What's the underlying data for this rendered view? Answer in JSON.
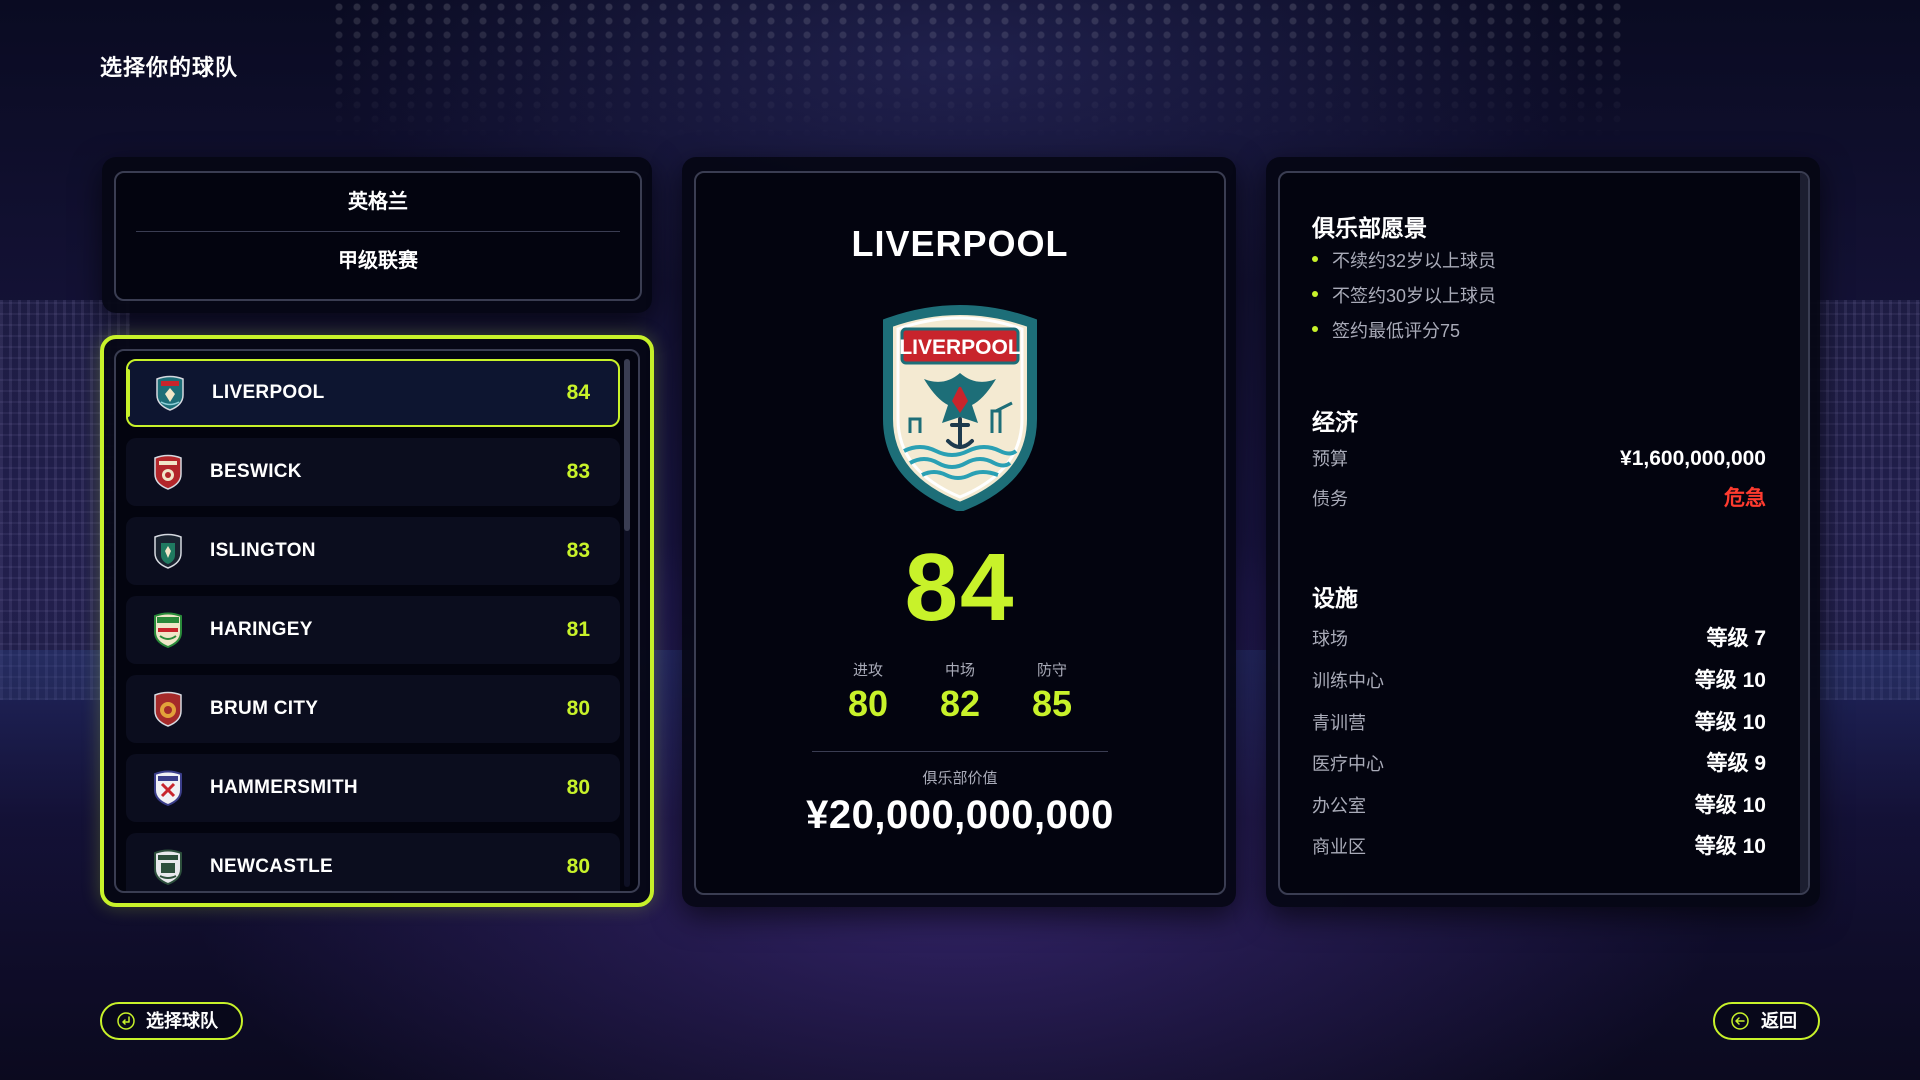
{
  "screen_title": "选择你的球队",
  "league_selector": {
    "country": "英格兰",
    "league": "甲级联赛"
  },
  "teams": [
    {
      "name": "LIVERPOOL",
      "rating": "84",
      "crest_color": "#1d6e78",
      "selected": true
    },
    {
      "name": "BESWICK",
      "rating": "83",
      "crest_color": "#b3262a",
      "selected": false
    },
    {
      "name": "ISLINGTON",
      "rating": "83",
      "crest_color": "#1f5f4e",
      "selected": false
    },
    {
      "name": "HARINGEY",
      "rating": "81",
      "crest_color": "#2a8a3a",
      "selected": false
    },
    {
      "name": "BRUM CITY",
      "rating": "80",
      "crest_color": "#a52a2a",
      "selected": false
    },
    {
      "name": "HAMMERSMITH",
      "rating": "80",
      "crest_color": "#3b3e8a",
      "selected": false
    },
    {
      "name": "NEWCASTLE",
      "rating": "80",
      "crest_color": "#2d4f3c",
      "selected": false
    }
  ],
  "detail": {
    "team_name": "LIVERPOOL",
    "crest_text": "LIVERPOOL",
    "overall": "84",
    "attack_label": "进攻",
    "attack": "80",
    "midfield_label": "中场",
    "midfield": "82",
    "defense_label": "防守",
    "defense": "85",
    "value_label": "俱乐部价值",
    "value": "¥20,000,000,000"
  },
  "info": {
    "vision_title": "俱乐部愿景",
    "vision_items": [
      "不续约32岁以上球员",
      "不签约30岁以上球员",
      "签约最低评分75"
    ],
    "economy_title": "经济",
    "budget_label": "预算",
    "budget_value": "¥1,600,000,000",
    "debt_label": "债务",
    "debt_value": "危急",
    "facilities_title": "设施",
    "facilities": [
      {
        "label": "球场",
        "value": "等级 7"
      },
      {
        "label": "训练中心",
        "value": "等级 10"
      },
      {
        "label": "青训营",
        "value": "等级 10"
      },
      {
        "label": "医疗中心",
        "value": "等级 9"
      },
      {
        "label": "办公室",
        "value": "等级 10"
      },
      {
        "label": "商业区",
        "value": "等级 10"
      }
    ]
  },
  "buttons": {
    "select": "选择球队",
    "back": "返回"
  },
  "colors": {
    "accent": "#c8f22a",
    "danger": "#ff3b2f",
    "muted_text": "#a9abb8"
  }
}
